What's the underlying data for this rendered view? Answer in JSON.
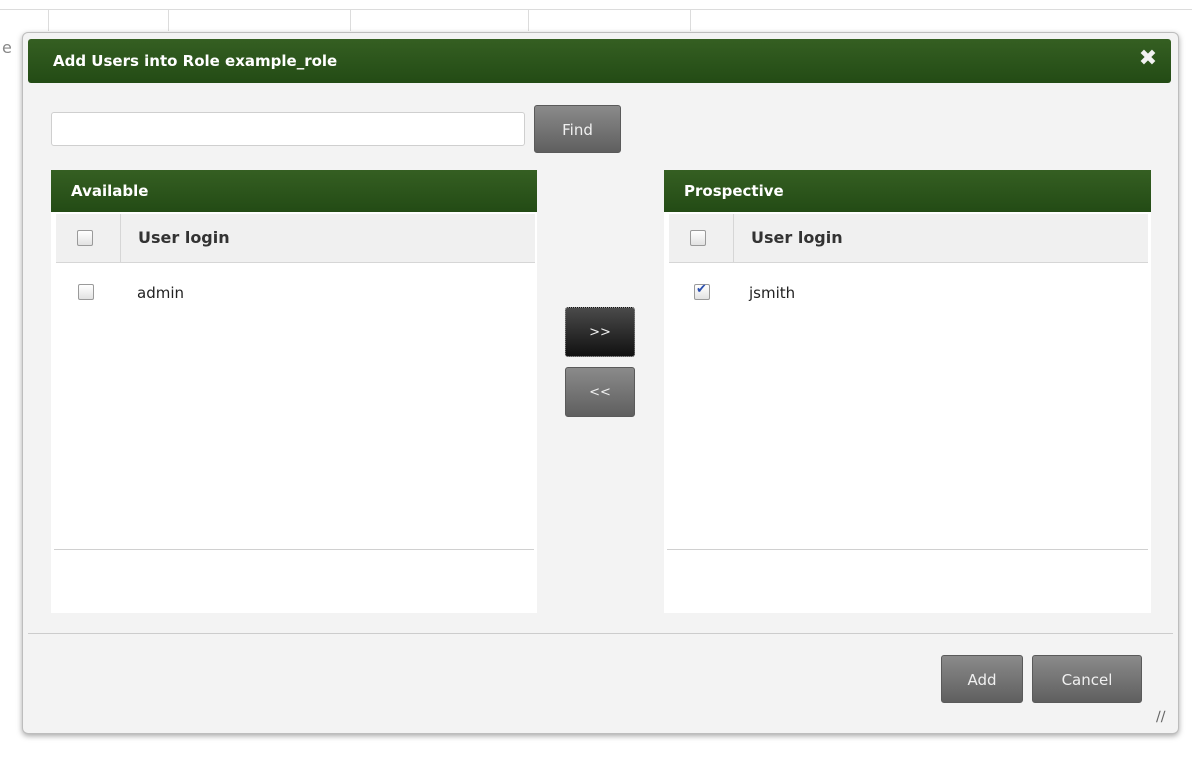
{
  "background": {
    "letter": "e"
  },
  "dialog": {
    "title": "Add Users into Role example_role",
    "close_icon": "close-icon",
    "search": {
      "value": "",
      "placeholder": ""
    },
    "find_label": "Find",
    "available": {
      "header": "Available",
      "column": "User login",
      "rows": [
        {
          "login": "admin",
          "checked": false
        }
      ]
    },
    "prospective": {
      "header": "Prospective",
      "column": "User login",
      "rows": [
        {
          "login": "jsmith",
          "checked": true
        }
      ]
    },
    "move_right_label": ">>",
    "move_left_label": "<<",
    "add_label": "Add",
    "cancel_label": "Cancel"
  },
  "colors": {
    "header_green": "#2e5c1c",
    "button_gray": "#6f6f6f"
  }
}
